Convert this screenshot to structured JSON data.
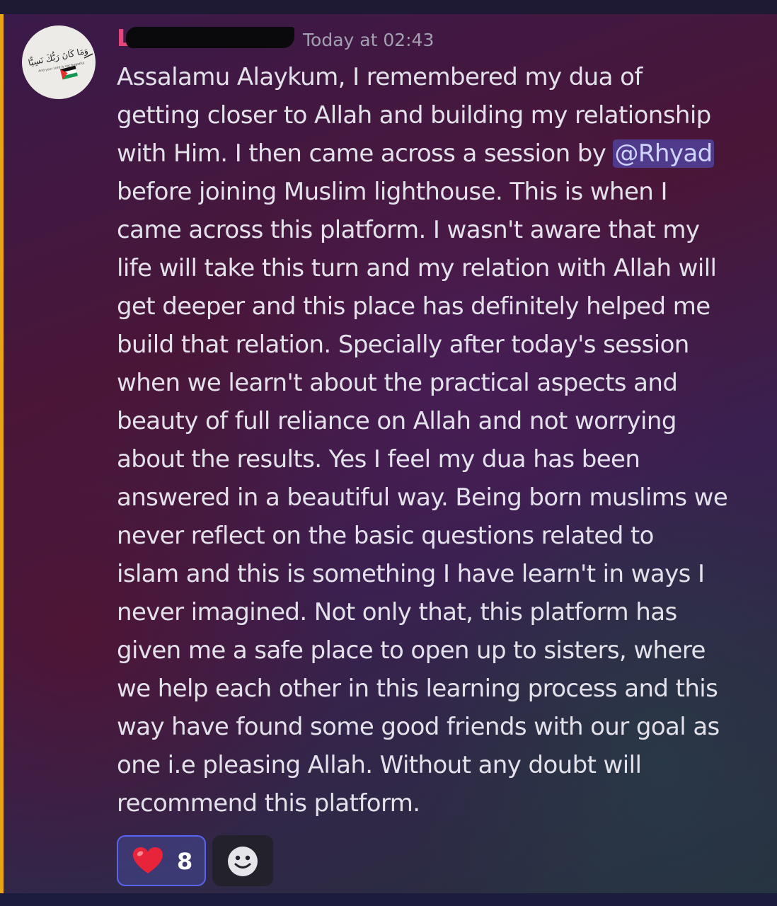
{
  "message": {
    "author": "La",
    "timestamp": "Today at 02:43",
    "lines": [
      {
        "text": "Assalamu Alaykum,  I remembered my dua of"
      },
      {
        "text": "getting closer to Allah and building my relationship"
      },
      {
        "text": "with Him. I then came across a session  by ",
        "mention": "@Rhyad"
      },
      {
        "text": "before joining Muslim lighthouse. This is when I"
      },
      {
        "text": "came across this platform. I wasn't aware that my"
      },
      {
        "text": "life will take this turn and my relation with Allah will"
      },
      {
        "text": "get deeper and this place has definitely helped me"
      },
      {
        "text": "build that relation. Specially after today's session"
      },
      {
        "text": "when we learn't about the practical aspects and"
      },
      {
        "text": "beauty of full reliance on Allah and not worrying"
      },
      {
        "text": "about the results. Yes I feel my dua has been"
      },
      {
        "text": "answered in a beautiful way. Being born muslims we"
      },
      {
        "text": "never reflect on the basic questions related to"
      },
      {
        "text": "islam and this is something I have learn't in ways I"
      },
      {
        "text": "never imagined. Not only that, this platform has"
      },
      {
        "text": "given me a safe place to open up to sisters, where"
      },
      {
        "text": "we help each other in this learning process and this"
      },
      {
        "text": "way have found some good friends with our goal as"
      },
      {
        "text": "one i.e pleasing Allah. Without any doubt will"
      },
      {
        "text": "recommend this platform."
      }
    ]
  },
  "avatar": {
    "arabic_text": "وَمَا كَانَ رَبُّكَ نَسِيًّا",
    "caption": "And your Lord is not forgetful"
  },
  "reactions": [
    {
      "emoji": "❤️",
      "count": "8",
      "icon": "heart-icon"
    }
  ],
  "add_reaction": {
    "icon": "smiley-face-icon"
  },
  "colors": {
    "username": "#e4467a",
    "highlight_bar": "#e8a317",
    "mention_bg": "#5865f2"
  }
}
